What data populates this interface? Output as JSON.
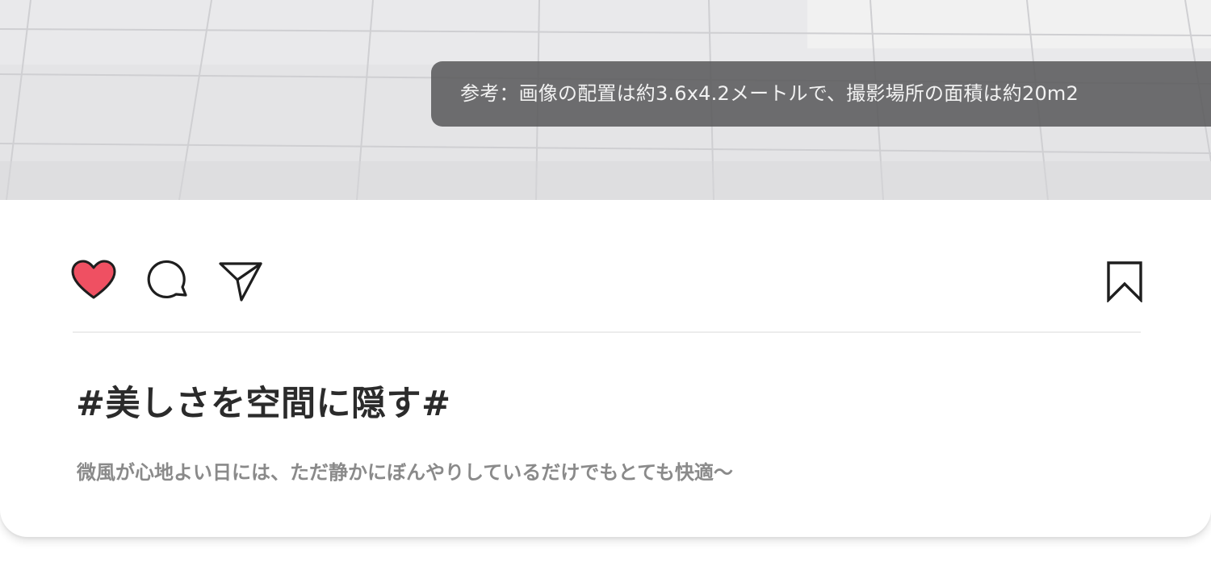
{
  "photo": {
    "caption": "参考：画像の配置は約3.6x4.2メートルで、撮影場所の面積は約20m2"
  },
  "actions": {
    "like_icon": "heart-icon",
    "like_color": "#ef5062",
    "comment_icon": "speech-bubble-icon",
    "share_icon": "paper-plane-icon",
    "save_icon": "bookmark-icon"
  },
  "post": {
    "title": "#美しさを空間に隠す#",
    "description": "微風が心地よい日には、ただ静かにぼんやりしているだけでもとても快適〜"
  }
}
